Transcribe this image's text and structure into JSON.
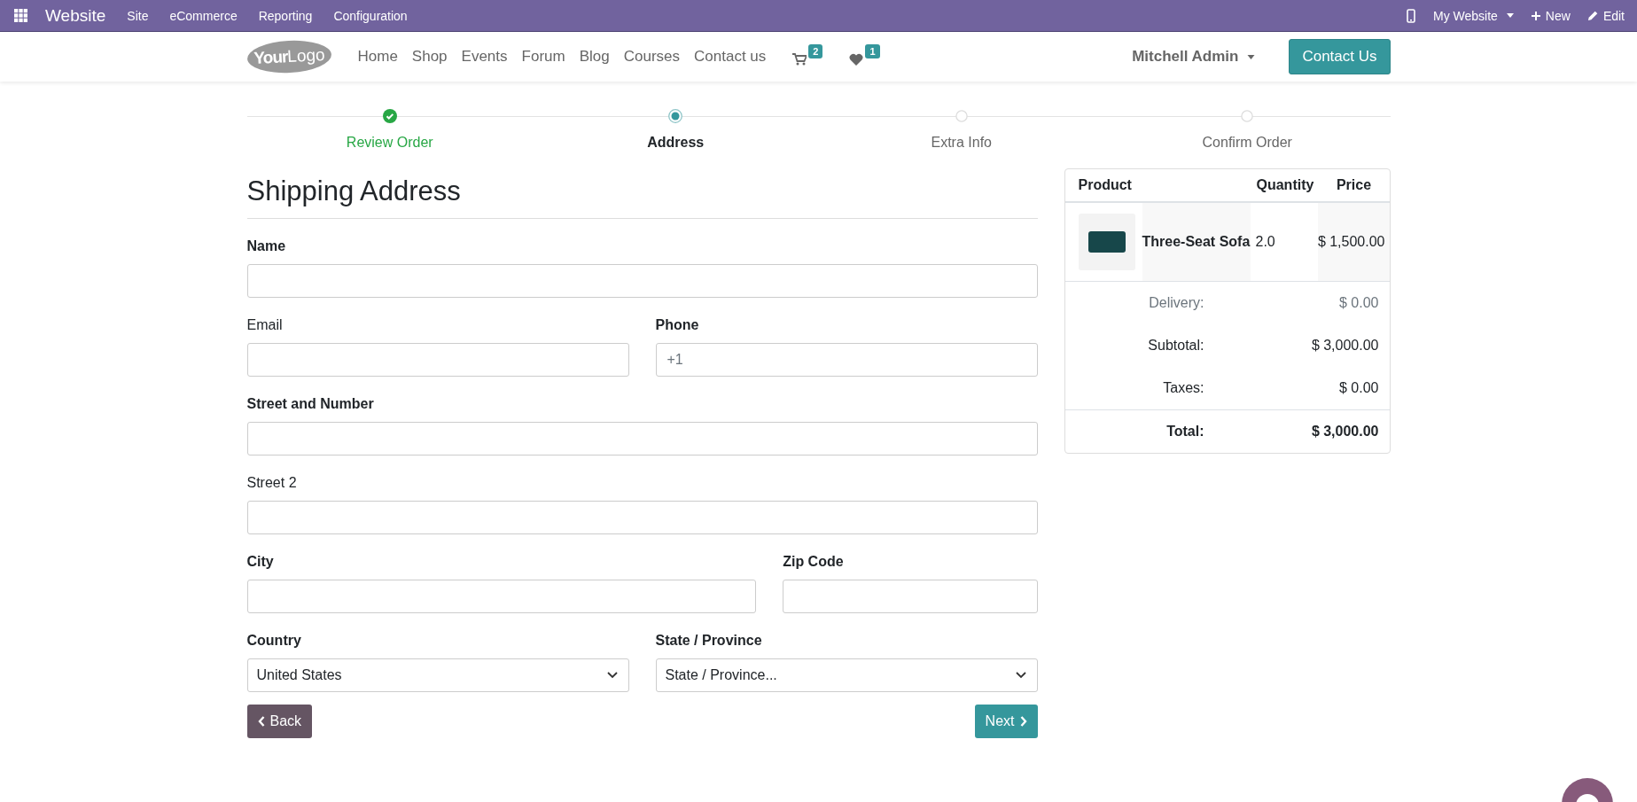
{
  "top_bar": {
    "app_title": "Website",
    "menu": [
      "Site",
      "eCommerce",
      "Reporting",
      "Configuration"
    ],
    "actions": [
      {
        "kind": "mobile"
      },
      {
        "kind": "dropdown",
        "label": "My Website"
      },
      {
        "kind": "new",
        "label": "New"
      },
      {
        "kind": "edit",
        "label": "Edit"
      }
    ]
  },
  "header": {
    "logo": {
      "bold": "Your",
      "light": "Logo"
    },
    "nav": [
      "Home",
      "Shop",
      "Events",
      "Forum",
      "Blog",
      "Courses",
      "Contact us"
    ],
    "cart_count": "2",
    "wishlist_count": "1",
    "user": "Mitchell Admin",
    "cta": "Contact Us"
  },
  "steps": [
    {
      "label": "Review Order",
      "completed": true,
      "selected": false
    },
    {
      "label": "Address",
      "completed": false,
      "selected": true
    },
    {
      "label": "Extra Info",
      "completed": false,
      "selected": false
    },
    {
      "label": "Confirm Order",
      "completed": false,
      "selected": false
    }
  ],
  "form": {
    "title": "Shipping Address",
    "rows": [
      [
        {
          "label": "Name",
          "required": true,
          "kind": "text"
        }
      ],
      [
        {
          "label": "Email",
          "required": false,
          "kind": "text"
        },
        {
          "label": "Phone",
          "required": true,
          "kind": "text",
          "placeholder": "+1"
        }
      ],
      [
        {
          "label": "Street and Number",
          "required": true,
          "kind": "text"
        }
      ],
      [
        {
          "label": "Street 2",
          "required": false,
          "kind": "text"
        }
      ],
      [
        {
          "label": "City",
          "required": true,
          "kind": "text",
          "wide": true
        },
        {
          "label": "Zip Code",
          "required": true,
          "kind": "text",
          "wide": false
        }
      ],
      [
        {
          "label": "Country",
          "required": true,
          "kind": "select",
          "value": "United States"
        },
        {
          "label": "State / Province",
          "required": true,
          "kind": "select",
          "value": "State / Province..."
        }
      ]
    ],
    "back": "Back",
    "next": "Next"
  },
  "summary": {
    "columns": [
      "Product",
      "Quantity",
      "Price"
    ],
    "rows": [
      {
        "product": "Three-Seat Sofa",
        "quantity": "2.0",
        "price": "$ 1,500.00"
      }
    ],
    "totals": [
      {
        "label": "Delivery:",
        "value": "$ 0.00",
        "kind": "muted"
      },
      {
        "label": "Subtotal:",
        "value": "$ 3,000.00",
        "kind": "normal"
      },
      {
        "label": "Taxes:",
        "value": "$ 0.00",
        "kind": "normal"
      },
      {
        "label": "Total:",
        "value": "$ 3,000.00",
        "kind": "total"
      }
    ]
  }
}
